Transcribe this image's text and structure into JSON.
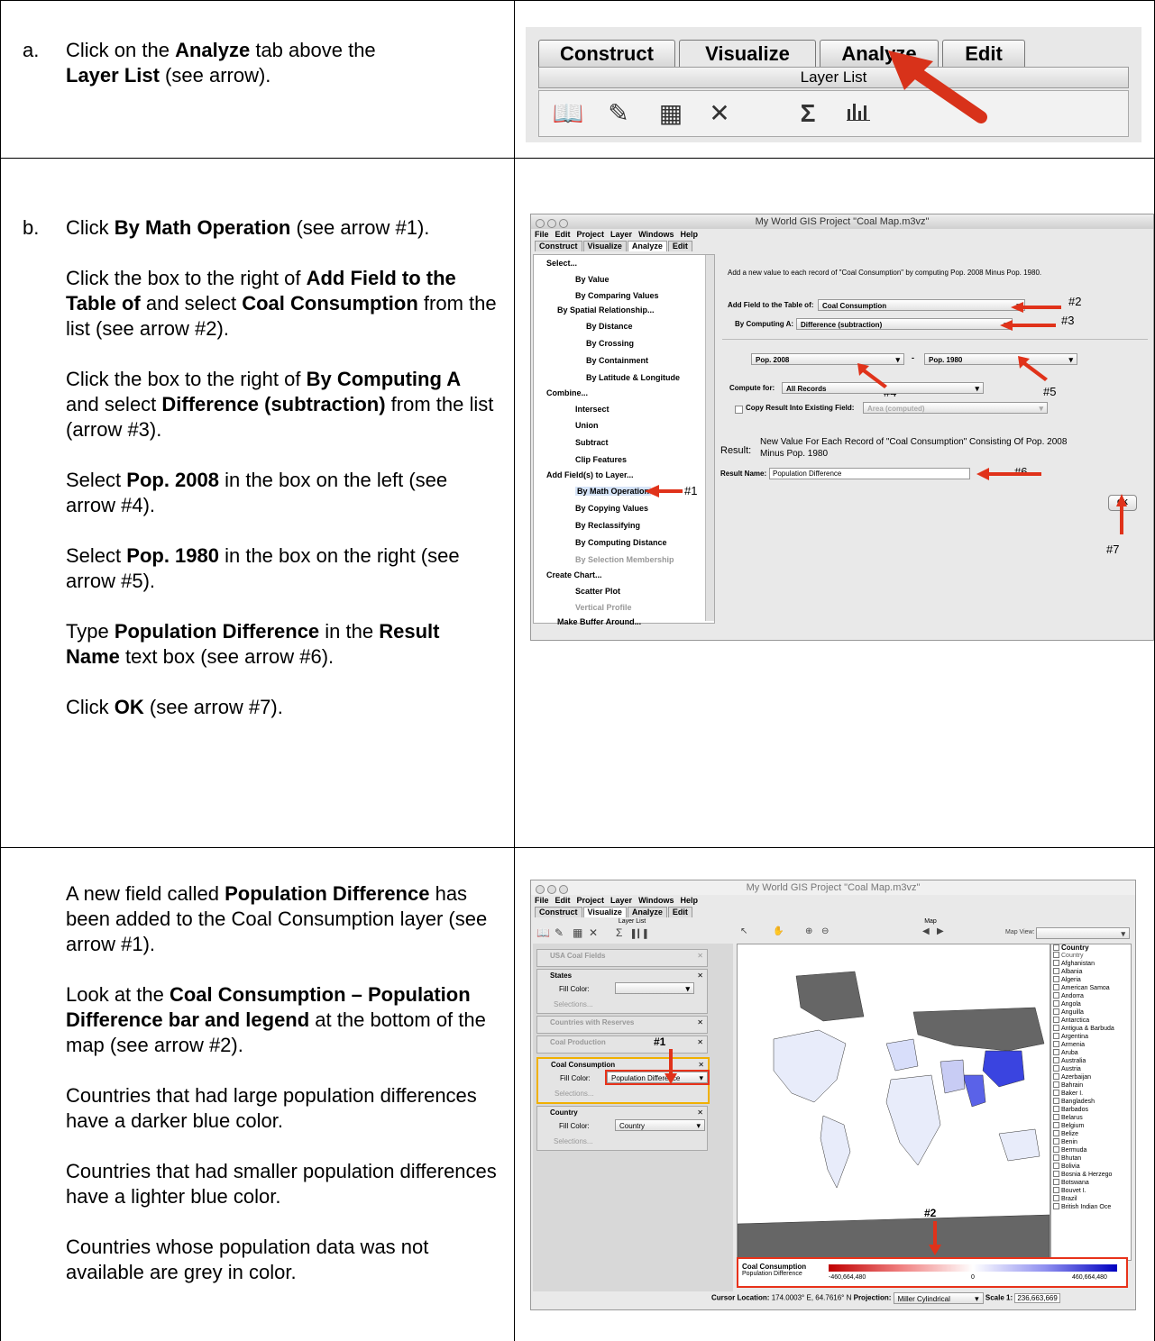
{
  "steps": {
    "a": {
      "marker": "a.",
      "line1_pre": "Click on the ",
      "line1_bold": "Analyze",
      "line1_post": " tab above the",
      "line2_bold": "Layer List",
      "line2_post": " (see arrow)."
    },
    "b": {
      "marker": "b.",
      "p1_pre": "Click ",
      "p1_bold": "By Math Operation",
      "p1_post": " (see arrow #1).",
      "p2_pre": "Click the box to the right of ",
      "p2_bold1": "Add Field to the Table of",
      "p2_mid": " and select ",
      "p2_bold2": "Coal Consumption",
      "p2_post": " from the list (see arrow #2).",
      "p3_pre": "Click the box to the right of ",
      "p3_bold1": "By Computing A",
      "p3_mid": " and select ",
      "p3_bold2": "Difference (subtraction)",
      "p3_post": " from the list (arrow #3).",
      "p4_pre": "Select ",
      "p4_bold": "Pop. 2008",
      "p4_post": " in the box on the left (see arrow #4).",
      "p5_pre": "Select ",
      "p5_bold": "Pop. 1980",
      "p5_post": " in the box on the right (see arrow #5).",
      "p6_pre": "Type ",
      "p6_bold1": "Population Difference",
      "p6_mid": " in the ",
      "p6_bold2": "Result Name",
      "p6_post": " text box (see arrow #6).",
      "p7_pre": "Click ",
      "p7_bold": "OK",
      "p7_post": " (see arrow #7)."
    },
    "c": {
      "p1_pre": "A new field called ",
      "p1_bold": "Population Difference",
      "p1_post": " has been added to the Coal Consumption layer (see arrow #1).",
      "p2_pre": "Look at the ",
      "p2_bold": "Coal Consumption – Population Difference bar and legend",
      "p2_post": " at the bottom of the map (see arrow #2).",
      "p3": "Countries that had large population differences have a darker blue color.",
      "p4": "Countries that had smaller population differences have a lighter blue color.",
      "p5": "Countries whose population data was not available are grey in color."
    }
  },
  "shot_a": {
    "tabs": [
      "Construct",
      "Visualize",
      "Analyze",
      "Edit"
    ],
    "layer_list": "Layer List",
    "icons": [
      "book-icon",
      "edit-icon",
      "table-icon",
      "close-icon",
      "sigma-icon",
      "bar-chart-icon"
    ]
  },
  "shot_b": {
    "title": "My World GIS Project \"Coal Map.m3vz\"",
    "menu": [
      "File",
      "Edit",
      "Project",
      "Layer",
      "Windows",
      "Help"
    ],
    "tabs": [
      "Construct",
      "Visualize",
      "Analyze",
      "Edit"
    ],
    "tree": [
      "Select...",
      "By Value",
      "By Comparing Values",
      "By Spatial Relationship...",
      "By Distance",
      "By Crossing",
      "By Containment",
      "By Latitude & Longitude",
      "Combine...",
      "Intersect",
      "Union",
      "Subtract",
      "Clip Features",
      "Add Field(s) to Layer...",
      "By Math Operation",
      "By Copying Values",
      "By Reclassifying",
      "By Computing Distance",
      "By Selection Membership",
      "Create Chart...",
      "Scatter Plot",
      "Vertical Profile",
      "Make Buffer Around..."
    ],
    "description": "Add a new value to each record of \"Coal Consumption\" by computing Pop. 2008 Minus Pop. 1980.",
    "add_field_label": "Add Field to the Table of:",
    "add_field_value": "Coal Consumption",
    "computing_label": "By Computing A:",
    "computing_value": "Difference (subtraction)",
    "left_operand": "Pop. 2008",
    "minus": "-",
    "right_operand": "Pop. 1980",
    "compute_for_label": "Compute for:",
    "compute_for_value": "All Records",
    "copy_label": "Copy Result Into Existing Field:",
    "copy_value": "Area (computed)",
    "result_label": "Result:",
    "result_text_1": "New Value For Each Record of \"Coal Consumption\" Consisting Of Pop. 2008",
    "result_text_2": "Minus Pop. 1980",
    "result_name_label": "Result Name:",
    "result_name_value": "Population Difference",
    "ok": "OK",
    "arrows": [
      "#1",
      "#2",
      "#3",
      "#4",
      "#5",
      "#6",
      "#7"
    ]
  },
  "shot_c": {
    "title": "My World GIS Project \"Coal Map.m3vz\"",
    "menu": [
      "File",
      "Edit",
      "Project",
      "Layer",
      "Windows",
      "Help"
    ],
    "tabs": [
      "Construct",
      "Visualize",
      "Analyze",
      "Edit"
    ],
    "layer_list": "Layer List",
    "map_label": "Map",
    "map_view_label": "Map View:",
    "layers": [
      {
        "name": "USA Coal Fields"
      },
      {
        "name": "States",
        "fill_label": "Fill Color:",
        "fill_value": ""
      },
      {
        "name": "Countries with Reserves"
      },
      {
        "name": "Coal Production"
      },
      {
        "name": "Coal Consumption",
        "fill_label": "Fill Color:",
        "fill_value": "Population Difference"
      },
      {
        "name": "Country",
        "fill_label": "Fill Color:",
        "fill_value": "Country"
      }
    ],
    "selections_label": "Selections...",
    "country_list_header": "Country",
    "country_list_sub": "Country",
    "countries": [
      "Afghanistan",
      "Albania",
      "Algeria",
      "American Samoa",
      "Andorra",
      "Angola",
      "Anguilla",
      "Antarctica",
      "Antigua & Barbuda",
      "Argentina",
      "Armenia",
      "Aruba",
      "Australia",
      "Austria",
      "Azerbaijan",
      "Bahrain",
      "Baker I.",
      "Bangladesh",
      "Barbados",
      "Belarus",
      "Belgium",
      "Belize",
      "Benin",
      "Bermuda",
      "Bhutan",
      "Bolivia",
      "Bosnia & Herzego",
      "Botswana",
      "Bouvet I.",
      "Brazil",
      "British Indian Oce"
    ],
    "legend_title": "Coal Consumption",
    "legend_sub": "Population Difference",
    "legend_min": "-460,664,480",
    "legend_mid": "0",
    "legend_max": "460,664,480",
    "cursor_label": "Cursor Location:",
    "cursor_value": "174.0003° E, 64.7616° N",
    "projection_label": "Projection:",
    "projection_value": "Miller Cylindrical",
    "scale_label": "Scale 1:",
    "scale_value": "236,663,669",
    "arrows": [
      "#1",
      "#2"
    ]
  }
}
